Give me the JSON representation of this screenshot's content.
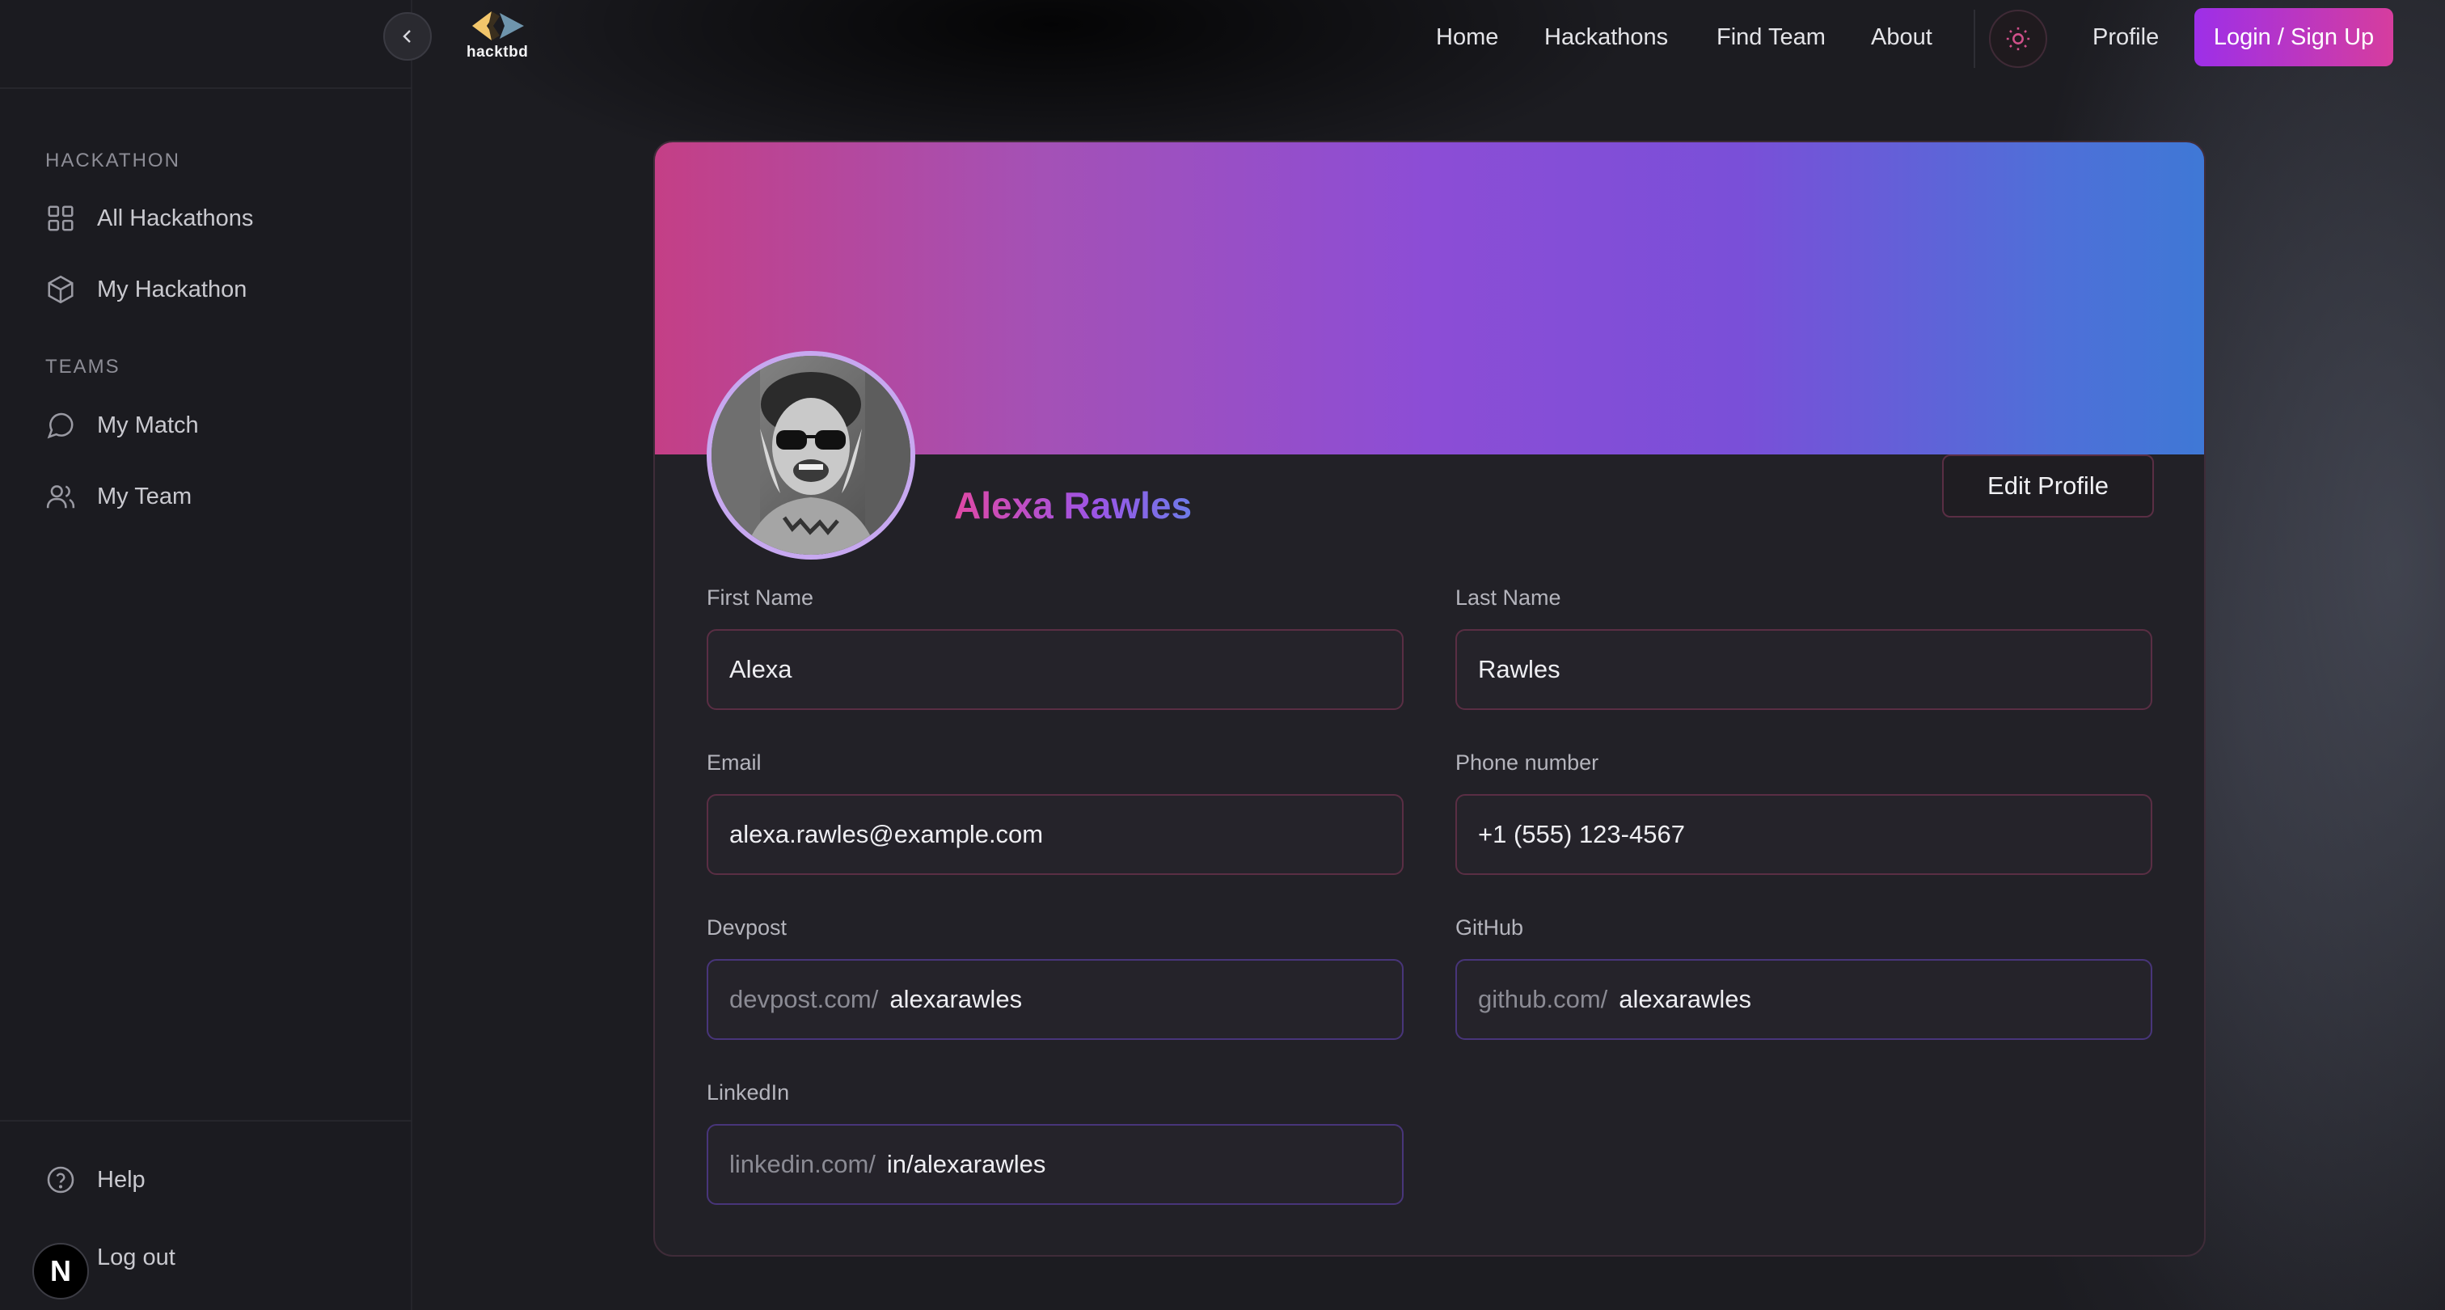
{
  "brand": {
    "name": "hacktbd"
  },
  "nav": {
    "links": [
      "Home",
      "Hackathons",
      "Find Team",
      "About"
    ],
    "profile": "Profile",
    "login": "Login / Sign Up"
  },
  "sidebar": {
    "sections": [
      {
        "label": "HACKATHON",
        "items": [
          "All Hackathons",
          "My Hackathon"
        ]
      },
      {
        "label": "TEAMS",
        "items": [
          "My Match",
          "My Team"
        ]
      }
    ],
    "footer": [
      "Help",
      "Log out"
    ],
    "avatar_letter": "N"
  },
  "profile": {
    "name": "Alexa Rawles",
    "edit_label": "Edit Profile",
    "fields": {
      "first_name": {
        "label": "First Name",
        "value": "Alexa"
      },
      "last_name": {
        "label": "Last Name",
        "value": "Rawles"
      },
      "email": {
        "label": "Email",
        "value": "alexa.rawles@example.com"
      },
      "phone": {
        "label": "Phone number",
        "value": "+1 (555) 123-4567"
      },
      "devpost": {
        "label": "Devpost",
        "prefix": "devpost.com/",
        "value": "alexarawles"
      },
      "github": {
        "label": "GitHub",
        "prefix": "github.com/",
        "value": "alexarawles"
      },
      "linkedin": {
        "label": "LinkedIn",
        "prefix": "linkedin.com/",
        "value": "in/alexarawles"
      }
    }
  },
  "icons": {
    "collapse": "chevron-left-icon",
    "theme": "sun-icon",
    "all_hackathons": "grid-icon",
    "my_hackathon": "cube-icon",
    "my_match": "chat-bubble-icon",
    "my_team": "users-icon",
    "help": "help-circle-icon"
  },
  "colors": {
    "accent_gradient_start": "#9d2fe8",
    "accent_gradient_end": "#d63d9e",
    "banner_start": "#c43f86",
    "banner_end": "#3f78d6"
  }
}
